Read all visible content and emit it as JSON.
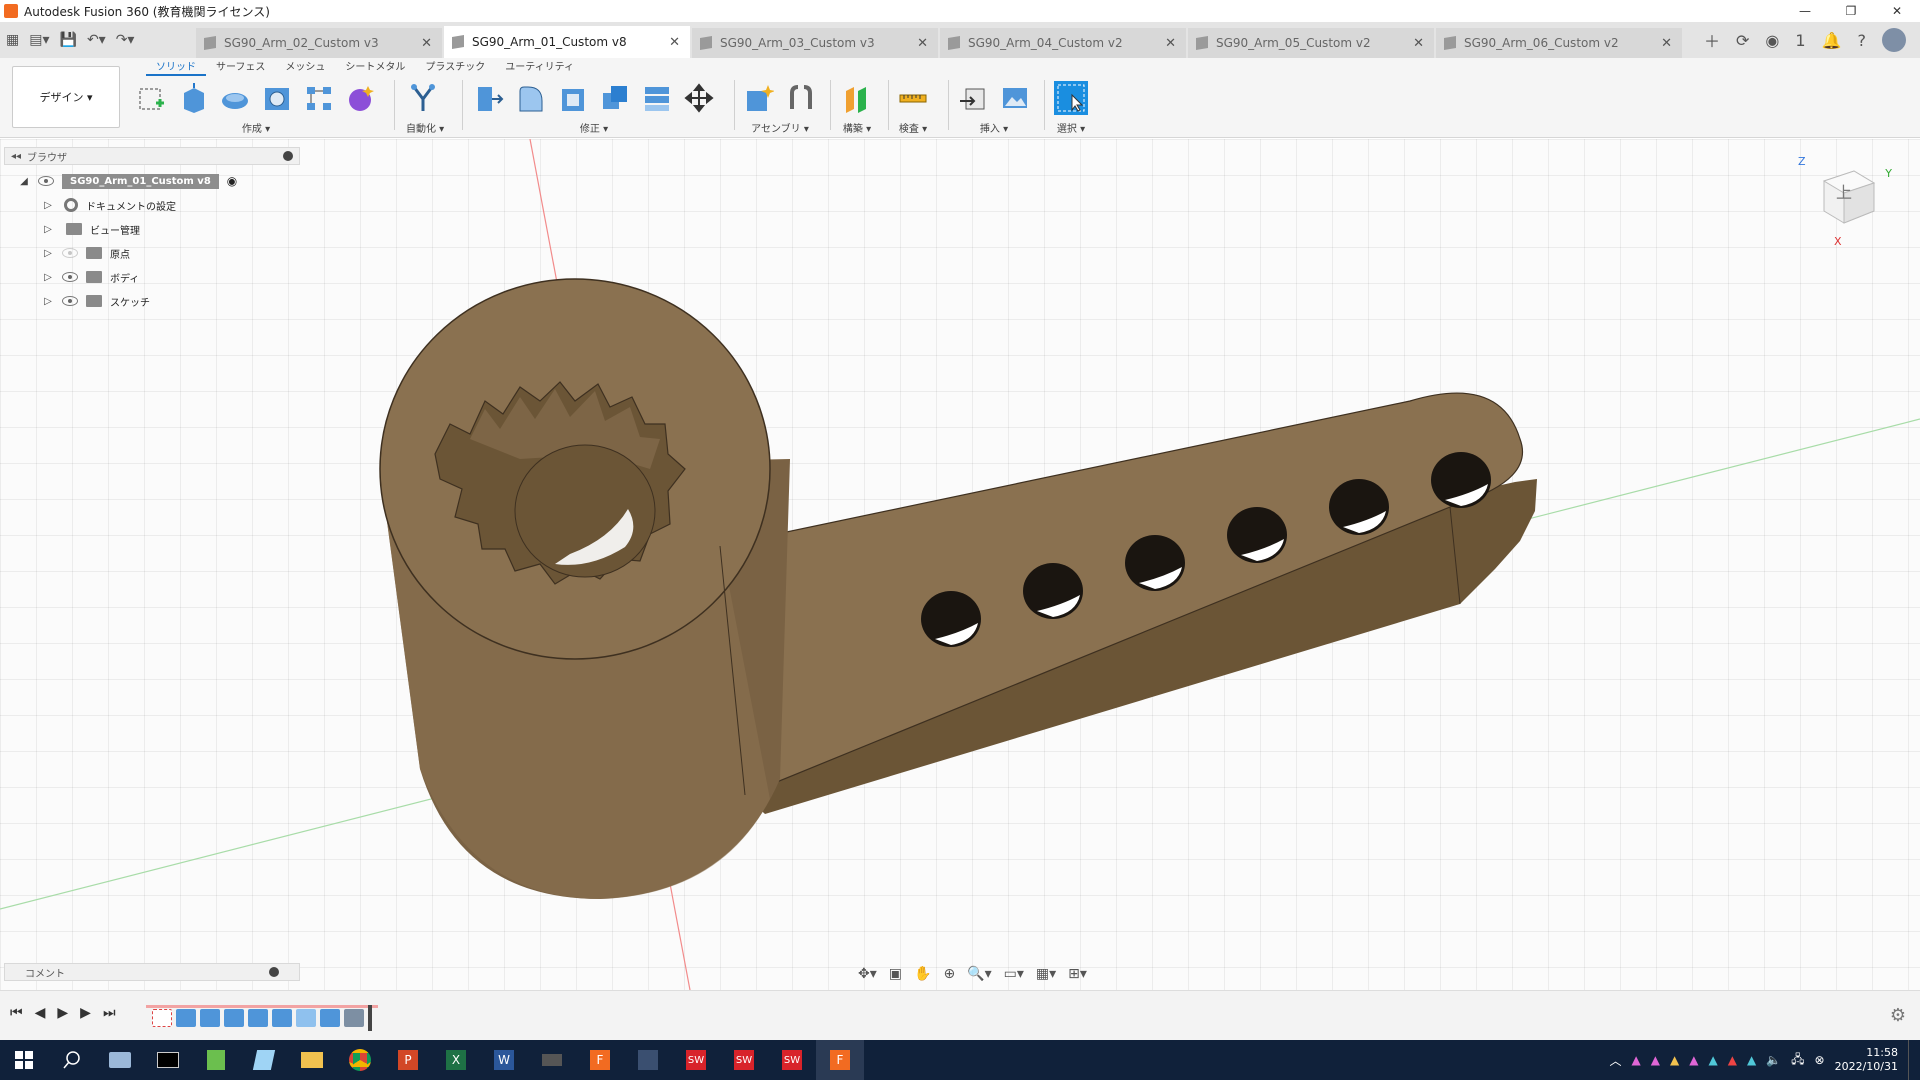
{
  "window": {
    "title": "Autodesk Fusion 360 (教育機関ライセンス)",
    "minimize": "—",
    "restore": "❐",
    "close": "✕"
  },
  "doc_tabs": [
    {
      "label": "SG90_Arm_02_Custom v3",
      "active": false
    },
    {
      "label": "SG90_Arm_01_Custom v8",
      "active": true
    },
    {
      "label": "SG90_Arm_03_Custom v3",
      "active": false
    },
    {
      "label": "SG90_Arm_04_Custom v2",
      "active": false
    },
    {
      "label": "SG90_Arm_05_Custom v2",
      "active": false
    },
    {
      "label": "SG90_Arm_06_Custom v2",
      "active": false
    }
  ],
  "header_right": {
    "job_count": "1"
  },
  "toolbar": {
    "workspace": "デザイン ▾",
    "categories": [
      "ソリッド",
      "サーフェス",
      "メッシュ",
      "シートメタル",
      "プラスチック",
      "ユーティリティ"
    ],
    "groups": {
      "create": "作成 ▾",
      "automate": "自動化 ▾",
      "modify": "修正 ▾",
      "assemble": "アセンブリ ▾",
      "construct": "構築 ▾",
      "inspect": "検査 ▾",
      "insert": "挿入 ▾",
      "select": "選択 ▾"
    }
  },
  "browser": {
    "header": "ブラウザ",
    "root": "SG90_Arm_01_Custom v8",
    "items": [
      {
        "label": "ドキュメントの設定"
      },
      {
        "label": "ビュー管理"
      },
      {
        "label": "原点"
      },
      {
        "label": "ボディ"
      },
      {
        "label": "スケッチ"
      }
    ]
  },
  "comments": {
    "label": "コメント"
  },
  "viewcube": {
    "face": "上",
    "axis_z": "Z",
    "axis_y": "Y",
    "axis_x": "X"
  },
  "colors": {
    "part": "#8a7150",
    "part_light": "#a08560",
    "part_dark": "#6b5536",
    "accent": "#1a73c8"
  },
  "taskbar": {
    "time": "11:58",
    "date": "2022/10/31"
  }
}
